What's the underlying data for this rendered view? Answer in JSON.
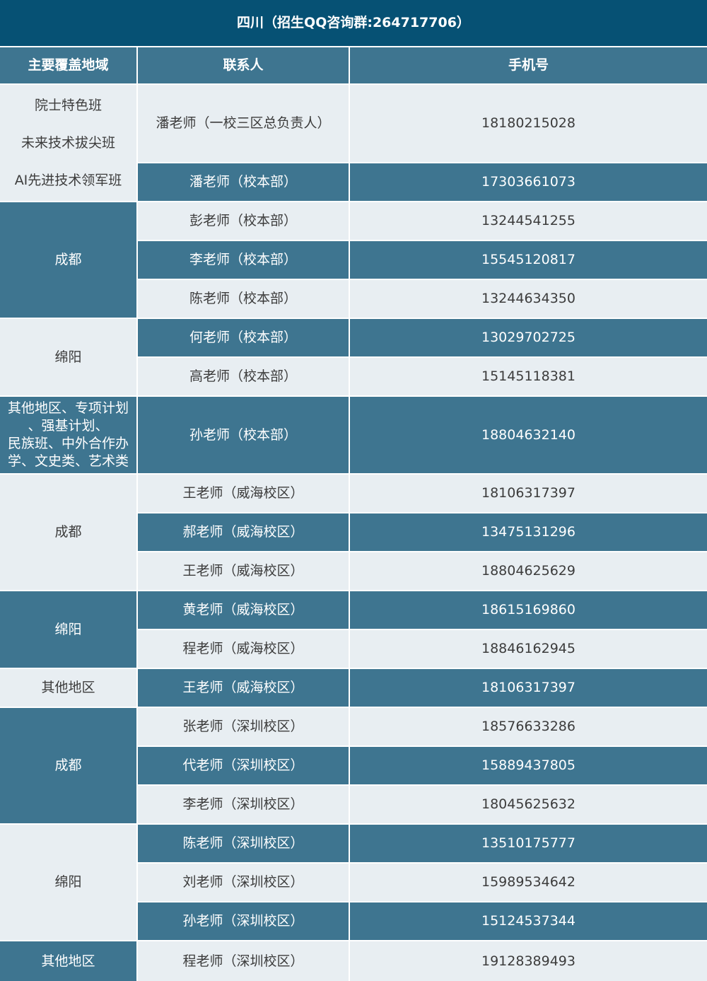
{
  "title": "四川（招生QQ咨询群:264717706）",
  "headers": {
    "region": "主要覆盖地域",
    "contact": "联系人",
    "phone": "手机号"
  },
  "regions": [
    {
      "lines": [
        "院士特色班",
        "未来技术拔尖班",
        "AI先进技术领军班"
      ]
    },
    {
      "lines": [
        "成都"
      ]
    },
    {
      "lines": [
        "绵阳"
      ]
    },
    {
      "lines": [
        "其他地区、专项计划",
        "、强基计划、",
        "民族班、中外合作办",
        "学、文史类、艺术类"
      ]
    },
    {
      "lines": [
        "成都"
      ]
    },
    {
      "lines": [
        "绵阳"
      ]
    },
    {
      "lines": [
        "其他地区"
      ]
    },
    {
      "lines": [
        "成都"
      ]
    },
    {
      "lines": [
        "绵阳"
      ]
    },
    {
      "lines": [
        "其他地区"
      ]
    }
  ],
  "rows": [
    {
      "contact": "潘老师（一校三区总负责人）",
      "phone": "18180215028"
    },
    {
      "contact": "潘老师（校本部）",
      "phone": "17303661073"
    },
    {
      "contact": "彭老师（校本部）",
      "phone": "13244541255"
    },
    {
      "contact": "李老师（校本部）",
      "phone": "15545120817"
    },
    {
      "contact": "陈老师（校本部）",
      "phone": "13244634350"
    },
    {
      "contact": "何老师（校本部）",
      "phone": "13029702725"
    },
    {
      "contact": "高老师（校本部）",
      "phone": "15145118381"
    },
    {
      "contact": "孙老师（校本部）",
      "phone": "18804632140"
    },
    {
      "contact": "王老师（威海校区）",
      "phone": "18106317397"
    },
    {
      "contact": "郝老师（威海校区）",
      "phone": "13475131296"
    },
    {
      "contact": "王老师（威海校区）",
      "phone": "18804625629"
    },
    {
      "contact": "黄老师（威海校区）",
      "phone": "18615169860"
    },
    {
      "contact": "程老师（威海校区）",
      "phone": "18846162945"
    },
    {
      "contact": "王老师（威海校区）",
      "phone": "18106317397"
    },
    {
      "contact": "张老师（深圳校区）",
      "phone": "18576633286"
    },
    {
      "contact": "代老师（深圳校区）",
      "phone": "15889437805"
    },
    {
      "contact": "李老师（深圳校区）",
      "phone": "18045625632"
    },
    {
      "contact": "陈老师（深圳校区）",
      "phone": "13510175777"
    },
    {
      "contact": "刘老师（深圳校区）",
      "phone": "15989534642"
    },
    {
      "contact": "孙老师（深圳校区）",
      "phone": "15124537344"
    },
    {
      "contact": "程老师（深圳校区）",
      "phone": "19128389493"
    }
  ],
  "colors": {
    "title_bg": "#065174",
    "dark": "#3e7590",
    "light": "#e8eef2"
  }
}
